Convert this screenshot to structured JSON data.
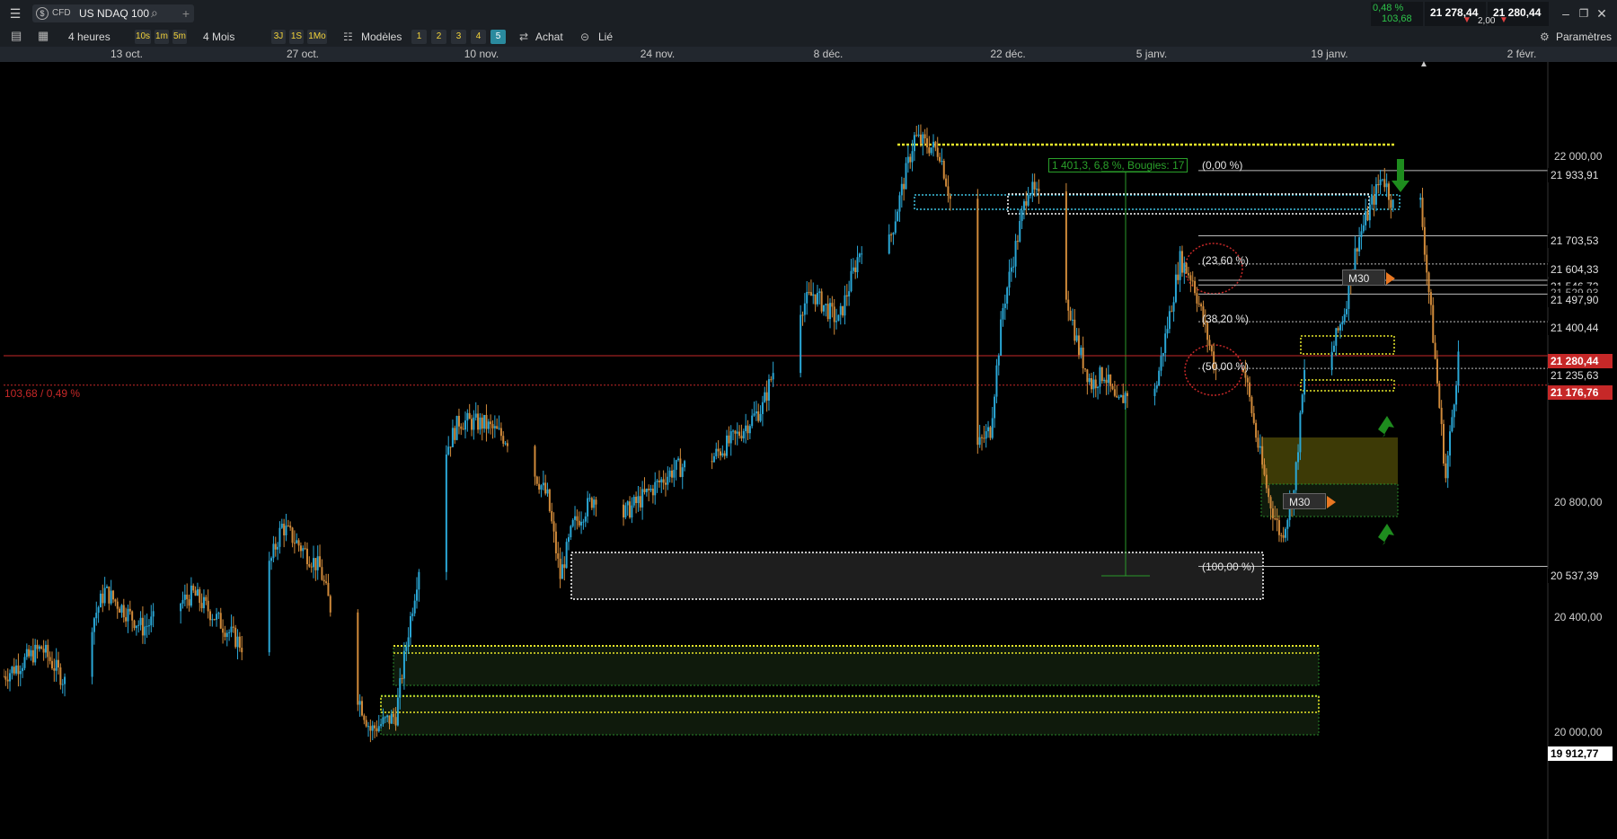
{
  "header": {
    "symbol_type": "CFD",
    "symbol_name": "US NDAQ 100",
    "change_pct": "0,48 %",
    "change_pts": "103,68",
    "bid": "21 278,44",
    "ask": "21 280,44",
    "spread": "2,00",
    "icons": [
      "hamburger-icon",
      "search-icon",
      "plus-icon",
      "minimize-icon",
      "restore-icon",
      "close-icon"
    ]
  },
  "toolbar": {
    "timeframe": "4 heures",
    "tf_buttons": [
      "10s",
      "1m",
      "5m"
    ],
    "range": "4 Mois",
    "range_buttons": [
      "3J",
      "1S",
      "1Mo"
    ],
    "templates_label": "Modèles",
    "number_buttons": [
      "1",
      "2",
      "3",
      "4",
      "5"
    ],
    "active_number": "5",
    "buy_label": "Achat",
    "link_label": "Lié",
    "settings_label": "Paramètres"
  },
  "date_axis": [
    "13 oct.",
    "27 oct.",
    "10 nov.",
    "24 nov.",
    "8 déc.",
    "22 déc.",
    "5 janv.",
    "19 janv.",
    "2 févr."
  ],
  "price_axis": {
    "labels": [
      "22 000,00",
      "20 800,00",
      "20 400,00",
      "20 000,00"
    ],
    "tags": [
      "21 933,91",
      "21 703,53",
      "21 604,33",
      "21 546,72",
      "21 529,93",
      "21 497,90",
      "21 400,44",
      "21 235,63",
      "20 537,39",
      "19 912,77"
    ],
    "current_bid_tag": "21 280,44",
    "current_ask_tag": "21 176,76",
    "change_line_label": "103,68 / 0,49 %"
  },
  "annotations": {
    "measure_label": "1 401,3, 6,8 %, Bougies: 17",
    "fib_levels": [
      "(0,00 %)",
      "(23,60 %)",
      "(38,20 %)",
      "(50,00 %)",
      "(100,00 %)"
    ],
    "m30_labels": [
      "M30",
      "M30"
    ]
  },
  "colors": {
    "bull": "#2aa7d6",
    "bear": "#d08a3a",
    "price_line": "#c62828",
    "zone_yellow": "#e8e82a",
    "zone_green": "#2a8a2a",
    "cyan_box": "#3ec1e0",
    "arrow_green": "#1e8c1e"
  },
  "chart_data": {
    "type": "candlestick",
    "instrument": "US NDAQ 100",
    "timeframe": "4 heures",
    "y_range": [
      19912.77,
      22200
    ],
    "x_start": "2025-10-06",
    "x_end": "2026-02-05",
    "anchors": [
      [
        "2025-10-06",
        20150
      ],
      [
        "2025-10-09",
        20250
      ],
      [
        "2025-10-11",
        20120
      ],
      [
        "2025-10-14",
        20450
      ],
      [
        "2025-10-17",
        20320
      ],
      [
        "2025-10-21",
        20440
      ],
      [
        "2025-10-25",
        20250
      ],
      [
        "2025-10-28",
        20680
      ],
      [
        "2025-10-31",
        20530
      ],
      [
        "2025-11-02",
        20200
      ],
      [
        "2025-11-04",
        19960
      ],
      [
        "2025-11-06",
        20010
      ],
      [
        "2025-11-07",
        20310
      ],
      [
        "2025-11-09",
        20850
      ],
      [
        "2025-11-11",
        21050
      ],
      [
        "2025-11-13",
        21040
      ],
      [
        "2025-11-16",
        20950
      ],
      [
        "2025-11-18",
        20780
      ],
      [
        "2025-11-19",
        20500
      ],
      [
        "2025-11-20",
        20680
      ],
      [
        "2025-11-22",
        20800
      ],
      [
        "2025-11-24",
        20720
      ],
      [
        "2025-11-26",
        20800
      ],
      [
        "2025-11-28",
        20880
      ],
      [
        "2025-12-01",
        20920
      ],
      [
        "2025-12-03",
        21000
      ],
      [
        "2025-12-05",
        21100
      ],
      [
        "2025-12-07",
        21400
      ],
      [
        "2025-12-09",
        21500
      ],
      [
        "2025-12-11",
        21400
      ],
      [
        "2025-12-13",
        21700
      ],
      [
        "2025-12-15",
        21680
      ],
      [
        "2025-12-17",
        22050
      ],
      [
        "2025-12-19",
        22000
      ],
      [
        "2025-12-20",
        21800
      ],
      [
        "2025-12-21",
        21260
      ],
      [
        "2025-12-22",
        20960
      ],
      [
        "2025-12-23",
        21020
      ],
      [
        "2025-12-24",
        21450
      ],
      [
        "2025-12-26",
        21880
      ],
      [
        "2025-12-28",
        21760
      ],
      [
        "2025-12-29",
        21500
      ],
      [
        "2025-12-30",
        21300
      ],
      [
        "2025-12-31",
        21180
      ],
      [
        "2026-01-01",
        21220
      ],
      [
        "2026-01-02",
        21100
      ],
      [
        "2026-01-04",
        21230
      ],
      [
        "2026-01-05",
        21150
      ],
      [
        "2026-01-07",
        21620
      ],
      [
        "2026-01-08",
        21550
      ],
      [
        "2026-01-10",
        21200
      ],
      [
        "2026-01-12",
        21250
      ],
      [
        "2026-01-13",
        21000
      ],
      [
        "2026-01-14",
        20780
      ],
      [
        "2026-01-15",
        20640
      ],
      [
        "2026-01-16",
        20800
      ],
      [
        "2026-01-17",
        21300
      ],
      [
        "2026-01-18",
        21150
      ],
      [
        "2026-01-20",
        21440
      ],
      [
        "2026-01-21",
        21680
      ],
      [
        "2026-01-23",
        21920
      ],
      [
        "2026-01-24",
        21790
      ],
      [
        "2026-01-25",
        21880
      ],
      [
        "2026-01-26",
        21820
      ],
      [
        "2026-01-27",
        21350
      ],
      [
        "2026-01-28",
        20850
      ],
      [
        "2026-01-29",
        21280
      ]
    ],
    "horizontal_lines": [
      21933.91,
      21703.53,
      21604.33,
      21546.72,
      21529.93,
      21497.9,
      21400.44,
      21280.44,
      21235.63,
      21176.76,
      20537.39
    ],
    "fibonacci": {
      "0%": 21933.91,
      "23.6%": 21604.33,
      "38.2%": 21400.44,
      "50%": 21235.63,
      "100%": 20537.39
    },
    "measure": {
      "change": "1 401,3",
      "pct": "6,8 %",
      "candles": 17
    },
    "zones": [
      {
        "name": "cyan-top",
        "from": 22050,
        "to": 22120
      },
      {
        "name": "white-mid",
        "from": 21860,
        "to": 21920
      },
      {
        "name": "white-low",
        "from": 20450,
        "to": 20630
      },
      {
        "name": "olive",
        "from": 20950,
        "to": 21110
      },
      {
        "name": "green-upper",
        "from": 20180,
        "to": 20310
      },
      {
        "name": "green-lower",
        "from": 19980,
        "to": 20090
      }
    ]
  }
}
